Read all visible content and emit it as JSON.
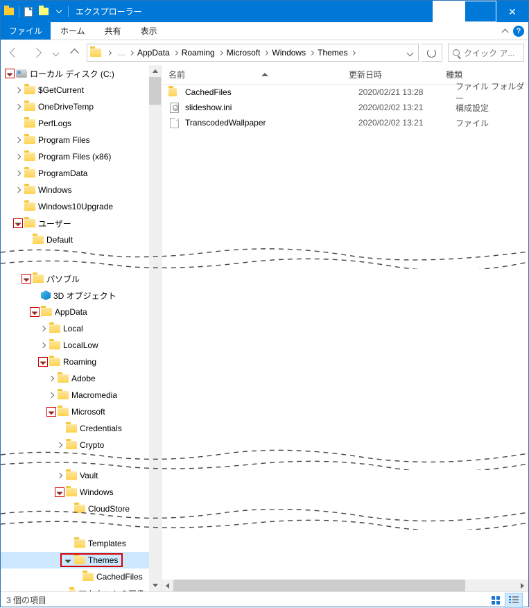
{
  "title": "エクスプローラー",
  "ribbon": {
    "file": "ファイル",
    "home": "ホーム",
    "share": "共有",
    "view": "表示"
  },
  "address": {
    "crumbs": [
      "AppData",
      "Roaming",
      "Microsoft",
      "Windows",
      "Themes"
    ],
    "search_placeholder": "クイック ア..."
  },
  "columns": {
    "name": "名前",
    "date": "更新日時",
    "type": "種類"
  },
  "files": [
    {
      "icon": "folder",
      "name": "CachedFiles",
      "date": "2020/02/21 13:28",
      "type": "ファイル フォルダー"
    },
    {
      "icon": "ini",
      "name": "slideshow.ini",
      "date": "2020/02/02 13:21",
      "type": "構成設定"
    },
    {
      "icon": "file",
      "name": "TranscodedWallpaper",
      "date": "2020/02/02 13:21",
      "type": "ファイル"
    }
  ],
  "tree": {
    "seg1": [
      {
        "depth": 0,
        "exp": "open",
        "red": true,
        "icon": "disk",
        "label": "ローカル ディスク (C:)"
      },
      {
        "depth": 1,
        "exp": "closed",
        "icon": "folder",
        "label": "$GetCurrent"
      },
      {
        "depth": 1,
        "exp": "closed",
        "icon": "folder",
        "label": "OneDriveTemp"
      },
      {
        "depth": 1,
        "exp": "none",
        "icon": "folder",
        "label": "PerfLogs"
      },
      {
        "depth": 1,
        "exp": "closed",
        "icon": "folder",
        "label": "Program Files"
      },
      {
        "depth": 1,
        "exp": "closed",
        "icon": "folder",
        "label": "Program Files (x86)"
      },
      {
        "depth": 1,
        "exp": "closed",
        "icon": "folder",
        "label": "ProgramData"
      },
      {
        "depth": 1,
        "exp": "closed",
        "icon": "folder",
        "label": "Windows"
      },
      {
        "depth": 1,
        "exp": "none",
        "icon": "folder",
        "label": "Windows10Upgrade"
      },
      {
        "depth": 1,
        "exp": "open",
        "red": true,
        "icon": "folder",
        "label": "ユーザー"
      },
      {
        "depth": 2,
        "exp": "none",
        "icon": "folder",
        "label": "Default"
      }
    ],
    "seg2": [
      {
        "depth": 2,
        "exp": "open",
        "red": true,
        "icon": "folder",
        "label": "パソブル"
      },
      {
        "depth": 3,
        "exp": "none",
        "icon": "3d",
        "label": "3D オブジェクト"
      },
      {
        "depth": 3,
        "exp": "open",
        "red": true,
        "icon": "folder",
        "label": "AppData"
      },
      {
        "depth": 4,
        "exp": "closed",
        "icon": "folder",
        "label": "Local"
      },
      {
        "depth": 4,
        "exp": "closed",
        "icon": "folder",
        "label": "LocalLow"
      },
      {
        "depth": 4,
        "exp": "open",
        "red": true,
        "icon": "folder",
        "label": "Roaming"
      },
      {
        "depth": 5,
        "exp": "closed",
        "icon": "folder",
        "label": "Adobe"
      },
      {
        "depth": 5,
        "exp": "closed",
        "icon": "folder",
        "label": "Macromedia"
      },
      {
        "depth": 5,
        "exp": "open",
        "red": true,
        "icon": "folder",
        "label": "Microsoft"
      },
      {
        "depth": 6,
        "exp": "none",
        "icon": "folder",
        "label": "Credentials"
      },
      {
        "depth": 6,
        "exp": "closed",
        "icon": "folder",
        "label": "Crypto"
      }
    ],
    "seg3": [
      {
        "depth": 6,
        "exp": "closed",
        "icon": "folder",
        "label": "Vault"
      },
      {
        "depth": 6,
        "exp": "open",
        "red": true,
        "icon": "folder",
        "label": "Windows"
      },
      {
        "depth": 7,
        "exp": "none",
        "icon": "folder",
        "label": "CloudStore"
      }
    ],
    "seg4": [
      {
        "depth": 7,
        "exp": "none",
        "icon": "folder",
        "label": "Templates"
      },
      {
        "depth": 7,
        "exp": "open",
        "icon": "folder",
        "label": "Themes",
        "selected": true,
        "themes": true
      },
      {
        "depth": 8,
        "exp": "none",
        "icon": "folder",
        "label": "CachedFiles"
      },
      {
        "depth": 7,
        "exp": "none",
        "icon": "folder",
        "label": "アカウントの画像"
      }
    ]
  },
  "status": "3 個の項目"
}
